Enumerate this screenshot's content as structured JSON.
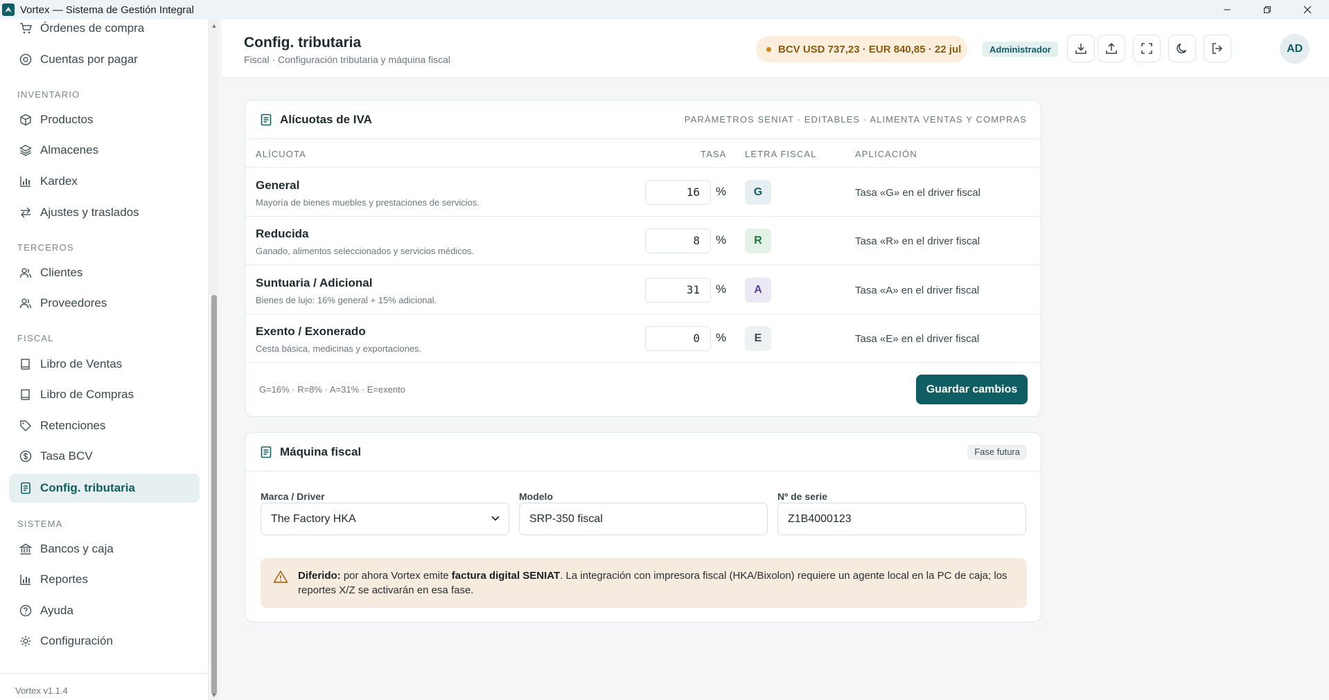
{
  "window": {
    "title": "Vortex — Sistema de Gestión Integral",
    "minimize_icon": "minimize-icon",
    "restore_icon": "restore-icon",
    "close_icon": "close-icon"
  },
  "sidebar": {
    "items_top": [
      {
        "label": "Órdenes de compra",
        "icon": "cart-icon"
      },
      {
        "label": "Cuentas por pagar",
        "icon": "coin-icon"
      }
    ],
    "sections": [
      {
        "title": "INVENTARIO",
        "items": [
          {
            "label": "Productos",
            "icon": "box-icon"
          },
          {
            "label": "Almacenes",
            "icon": "layers-icon"
          },
          {
            "label": "Kardex",
            "icon": "bar-chart-icon"
          },
          {
            "label": "Ajustes y traslados",
            "icon": "arrows-icon"
          }
        ]
      },
      {
        "title": "TERCEROS",
        "items": [
          {
            "label": "Clientes",
            "icon": "users-icon"
          },
          {
            "label": "Proveedores",
            "icon": "users-icon"
          }
        ]
      },
      {
        "title": "FISCAL",
        "items": [
          {
            "label": "Libro de Ventas",
            "icon": "book-icon"
          },
          {
            "label": "Libro de Compras",
            "icon": "book-icon"
          },
          {
            "label": "Retenciones",
            "icon": "tag-icon"
          },
          {
            "label": "Tasa BCV",
            "icon": "dollar-circle-icon"
          },
          {
            "label": "Config. tributaria",
            "icon": "receipt-icon",
            "active": true
          }
        ]
      },
      {
        "title": "SISTEMA",
        "items": [
          {
            "label": "Bancos y caja",
            "icon": "bank-icon"
          },
          {
            "label": "Reportes",
            "icon": "bar-chart-icon"
          },
          {
            "label": "Ayuda",
            "icon": "help-icon"
          },
          {
            "label": "Configuración",
            "icon": "gear-icon"
          }
        ]
      }
    ],
    "version": "Vortex v1.1.4"
  },
  "header": {
    "title": "Config. tributaria",
    "subtitle": "Fiscal · Configuración tributaria y máquina fiscal",
    "bcv_rate": "BCV USD 737,23 · EUR 840,85 · 22 jul",
    "role": "Administrador",
    "avatar": "AD",
    "buttons": [
      "download-icon",
      "upload-icon",
      "fullscreen-icon",
      "moon-icon",
      "logout-icon"
    ]
  },
  "iva_card": {
    "title": "Alícuotas de IVA",
    "meta": "PARÁMETROS SENIAT · EDITABLES · ALIMENTA VENTAS Y COMPRAS",
    "columns": {
      "alicuota": "ALÍCUOTA",
      "tasa": "TASA",
      "letra": "LETRA FISCAL",
      "aplicacion": "APLICACIÓN"
    },
    "rows": [
      {
        "name": "General",
        "desc": "Mayoría de bienes muebles y prestaciones de servicios.",
        "rate": "16",
        "pct": "%",
        "letter": "G",
        "letter_bg": "#e7eff2",
        "letter_fg": "#0f5e63",
        "app": "Tasa «G» en el driver fiscal"
      },
      {
        "name": "Reducida",
        "desc": "Ganado, alimentos seleccionados y servicios médicos.",
        "rate": "8",
        "pct": "%",
        "letter": "R",
        "letter_bg": "#e2f2e6",
        "letter_fg": "#1e7a3c",
        "app": "Tasa «R» en el driver fiscal"
      },
      {
        "name": "Suntuaria / Adicional",
        "desc": "Bienes de lujo: 16% general + 15% adicional.",
        "rate": "31",
        "pct": "%",
        "letter": "A",
        "letter_bg": "#ece8f6",
        "letter_fg": "#5a4596",
        "app": "Tasa «A» en el driver fiscal"
      },
      {
        "name": "Exento / Exonerado",
        "desc": "Cesta básica, medicinas y exportaciones.",
        "rate": "0",
        "pct": "%",
        "letter": "E",
        "letter_bg": "#eef1f2",
        "letter_fg": "#3a4850",
        "app": "Tasa «E» en el driver fiscal"
      }
    ],
    "summary": "G=16% · R=8% · A=31% · E=exento",
    "save_label": "Guardar cambios"
  },
  "fiscal_card": {
    "title": "Máquina fiscal",
    "badge": "Fase futura",
    "brand_label": "Marca / Driver",
    "brand_value": "The Factory HKA",
    "model_label": "Modelo",
    "model_value": "SRP-350 fiscal",
    "serial_label": "Nº de serie",
    "serial_value": "Z1B4000123",
    "notice_strong1": "Diferido:",
    "notice_text1": " por ahora Vortex emite ",
    "notice_strong2": "factura digital SENIAT",
    "notice_text2": ". La integración con impresora fiscal (HKA/Bixolon) requiere un agente local en la PC de caja; los reportes X/Z se activarán en esa fase."
  },
  "colors": {
    "accent": "#0f5e63",
    "bcv_pill": "#fbeedd",
    "notice": "#f6ebdf"
  }
}
